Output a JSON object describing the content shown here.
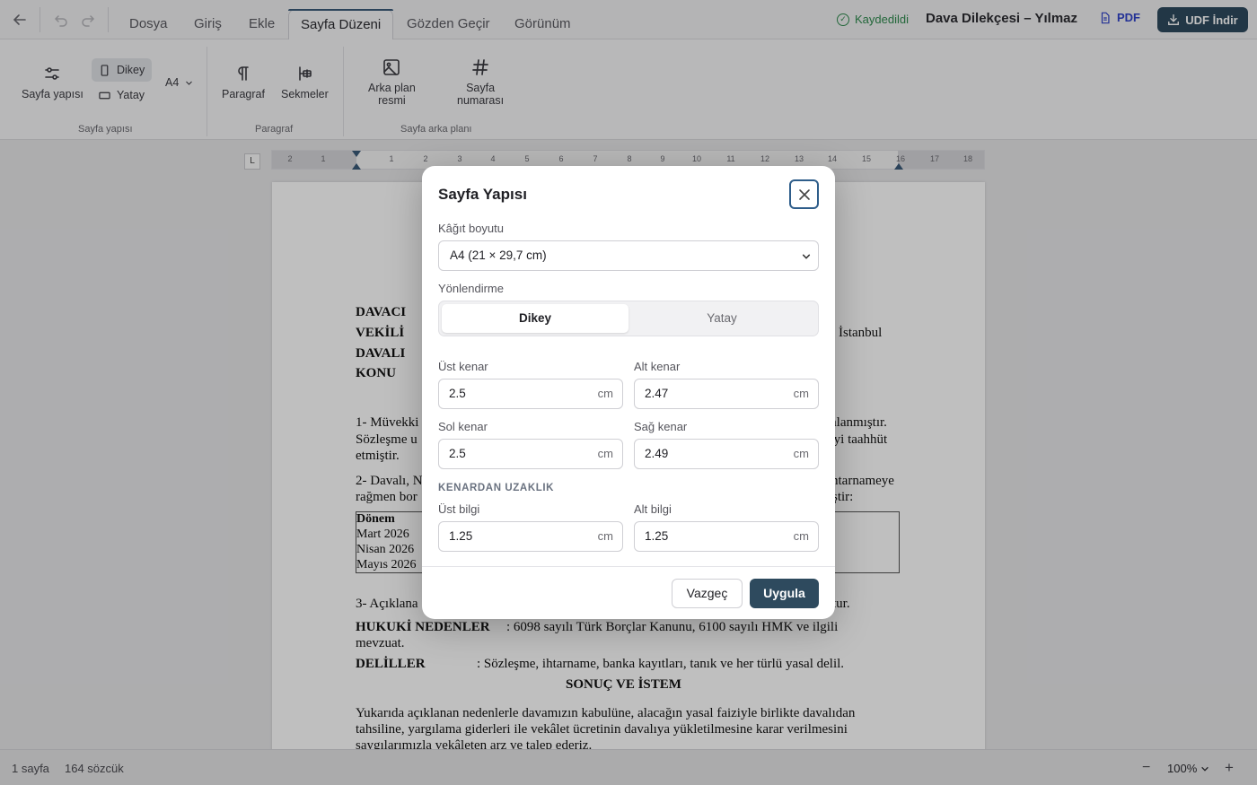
{
  "topbar": {
    "tabs": [
      {
        "label": "Dosya"
      },
      {
        "label": "Giriş"
      },
      {
        "label": "Ekle"
      },
      {
        "label": "Sayfa Düzeni"
      },
      {
        "label": "Gözden Geçir"
      },
      {
        "label": "Görünüm"
      }
    ],
    "active_tab": "Sayfa Düzeni",
    "saved_status": "Kaydedildi",
    "document_title": "Dava Dilekçesi – Yılmaz",
    "pdf_label": "PDF",
    "udf_label": "UDF İndir",
    "accent_color": "#2e4a5e"
  },
  "ribbon": {
    "page_setup_label": "Sayfa yapısı",
    "portrait_label": "Dikey",
    "landscape_label": "Yatay",
    "paper_size": "A4",
    "paragraph_label": "Paragraf",
    "tabs_label": "Sekmeler",
    "bg_image_label_1": "Arka plan",
    "bg_image_label_2": "resmi",
    "page_number_label_1": "Sayfa",
    "page_number_label_2": "numarası",
    "group_page_setup": "Sayfa yapısı",
    "group_paragraph": "Paragraf",
    "group_page_bg": "Sayfa arka planı"
  },
  "ruler": {
    "corner": "L",
    "ticks": [
      "2",
      "1",
      "1",
      "2",
      "3",
      "4",
      "5",
      "6",
      "7",
      "8",
      "9",
      "10",
      "11",
      "12",
      "13",
      "14",
      "15",
      "16",
      "17",
      "18"
    ]
  },
  "document": {
    "davaci": "DAVACI",
    "vekili": "VEKİLİ",
    "davali": "DAVALI",
    "konu": "KONU",
    "istanbul": "İstanbul",
    "p1_a": "1- Müvekki",
    "p1_b": "alanmıştır.",
    "p1_c": "Sözleşme u",
    "p1_d": "eyi taahhüt",
    "p1_e": "etmiştir.",
    "p2_a": "2- Davalı, N",
    "p2_b": "htarnameye",
    "p2_c": "rağmen bor",
    "p2_d": "ştir:",
    "table_header": "Dönem",
    "table_rows": [
      "Mart 2026",
      "Nisan 2026",
      "Mayıs 2026"
    ],
    "p3_a": "3- Açıklana",
    "p3_b": "tur.",
    "hukuki_label": "HUKUKİ NEDENLER",
    "hukuki_text": ": 6098 sayılı Türk Borçlar Kanunu, 6100 sayılı HMK ve ilgili",
    "hukuki_text2": "mevzuat.",
    "deliller_label": "DELİLLER",
    "deliller_text": ": Sözleşme, ihtarname, banka kayıtları, tanık ve her türlü yasal delil.",
    "sonuc": "SONUÇ VE İSTEM",
    "sonuc_text1": "Yukarıda açıklanan nedenlerle davamızın kabulüne, alacağın yasal faiziyle birlikte davalıdan",
    "sonuc_text2": "tahsiline, yargılama giderleri ile vekâlet ücretinin davalıya yükletilmesine karar verilmesini",
    "sonuc_text3": "saygılarımızla vekâleten arz ve talep ederiz."
  },
  "modal": {
    "title": "Sayfa Yapısı",
    "paper_size_label": "Kâğıt boyutu",
    "paper_size_value": "A4 (21 × 29,7 cm)",
    "orientation_label": "Yönlendirme",
    "orientation_options": [
      "Dikey",
      "Yatay"
    ],
    "orientation_selected": "Dikey",
    "top_margin_label": "Üst kenar",
    "top_margin_value": "2.5",
    "bottom_margin_label": "Alt kenar",
    "bottom_margin_value": "2.47",
    "left_margin_label": "Sol kenar",
    "left_margin_value": "2.5",
    "right_margin_label": "Sağ kenar",
    "right_margin_value": "2.49",
    "section_label": "KENARDAN UZAKLIK",
    "header_label": "Üst bilgi",
    "header_value": "1.25",
    "footer_label": "Alt bilgi",
    "footer_value": "1.25",
    "unit": "cm",
    "cancel_label": "Vazgeç",
    "apply_label": "Uygula"
  },
  "statusbar": {
    "pages": "1 sayfa",
    "words": "164 sözcük",
    "zoom": "100%",
    "zoom_out": "−",
    "zoom_in": "+"
  }
}
